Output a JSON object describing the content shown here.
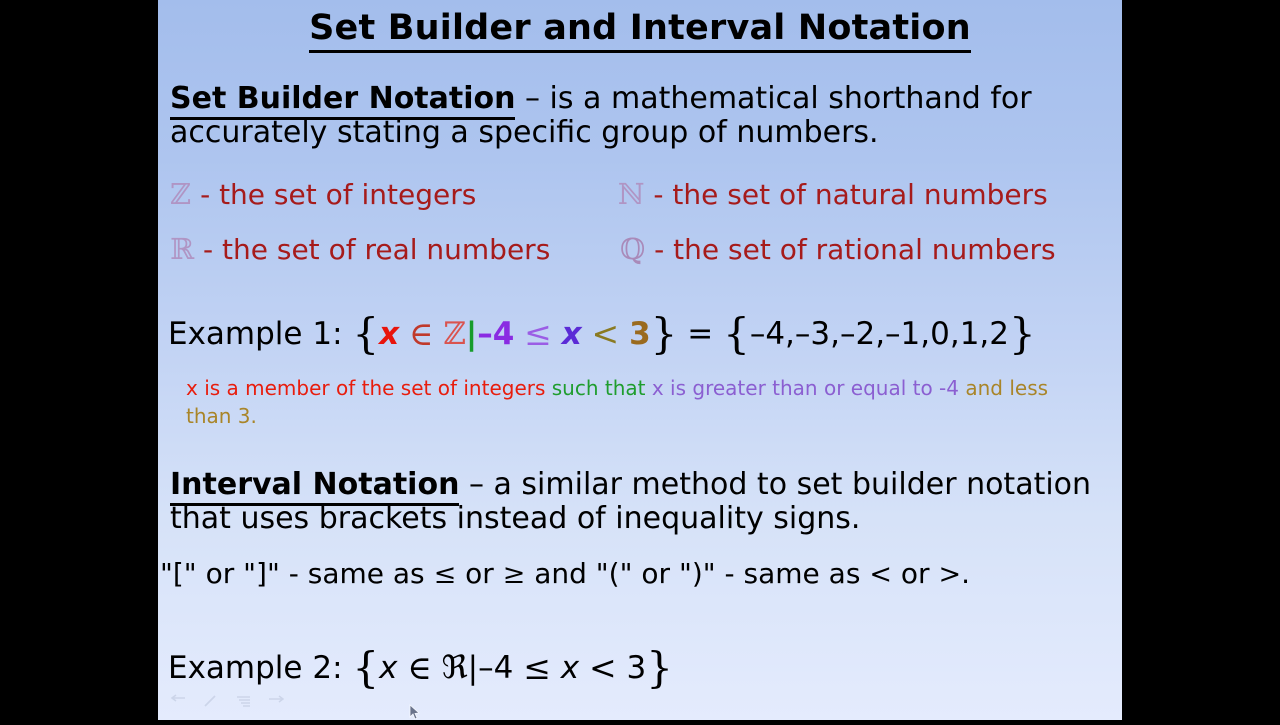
{
  "slide": {
    "title": "Set Builder and Interval Notation",
    "set_builder": {
      "heading": "Set Builder Notation",
      "dash_text": " – is a mathematical shorthand for accurately stating a specific group of numbers."
    },
    "sets": [
      {
        "symbol": "ℤ",
        "label": "- the set of integers"
      },
      {
        "symbol": "ℕ",
        "label": "- the set of natural numbers"
      },
      {
        "symbol": "ℝ",
        "label": "- the set of real numbers"
      },
      {
        "symbol": "ℚ",
        "label": "- the set of rational numbers"
      }
    ],
    "example1": {
      "label": "Example 1:",
      "open_brace": "{",
      "var": "x",
      "member_sign": "∈",
      "set_symbol": "ℤ",
      "such_that_bar": "|",
      "lower_bound": "–4",
      "lower_op": "≤",
      "var2": "x",
      "upper_op": "<",
      "upper_bound": "3",
      "close_brace": "}",
      "equals": "=",
      "result_open": "{",
      "result": "–4,–3,–2,–1,0,1,2",
      "result_close": "}"
    },
    "explanation": {
      "part_red": "x is a member of the set of integers",
      "part_green": "such that",
      "part_purple": "x is greater than or equal to -4",
      "part_olive": "and less than 3."
    },
    "interval": {
      "heading": "Interval Notation",
      "dash_text": " – a similar method to set builder notation that uses brackets instead of inequality signs."
    },
    "brackets_line": {
      "q1": "\"[\"",
      "or1": "or",
      "q2": "\"]\"",
      "dash1": "- same as",
      "le": "≤",
      "or2": "or",
      "ge": "≥",
      "and": "and",
      "q3": "\"(\"",
      "or3": "or",
      "q4": "\")\"",
      "dash2": "- same as",
      "lt": "<",
      "or4": "or",
      "gt": ">",
      "period": "."
    },
    "example2": {
      "label": "Example 2:",
      "open_brace": "{",
      "var": "x",
      "member_sign": "∈",
      "set_symbol": "ℜ",
      "such_that_bar": "|",
      "lower_bound": "–4",
      "lower_op": "≤",
      "var2": "x",
      "upper_op": "<",
      "upper_bound": "3",
      "close_brace": "}"
    },
    "toolbar_icons": [
      "pointer-arrow-icon",
      "pen-icon",
      "highlighter-icon",
      "navigation-icon"
    ],
    "colors": {
      "background_top": "#a3bdec",
      "background_bottom": "#e4ebfd",
      "letterbox": "#000000",
      "set_label_text": "#a61b1b",
      "set_symbol": "#b095c4",
      "explain_red": "#e81d0d",
      "explain_green": "#1f9d2e",
      "explain_purple": "#8b5fd1",
      "explain_olive": "#a98529"
    }
  }
}
